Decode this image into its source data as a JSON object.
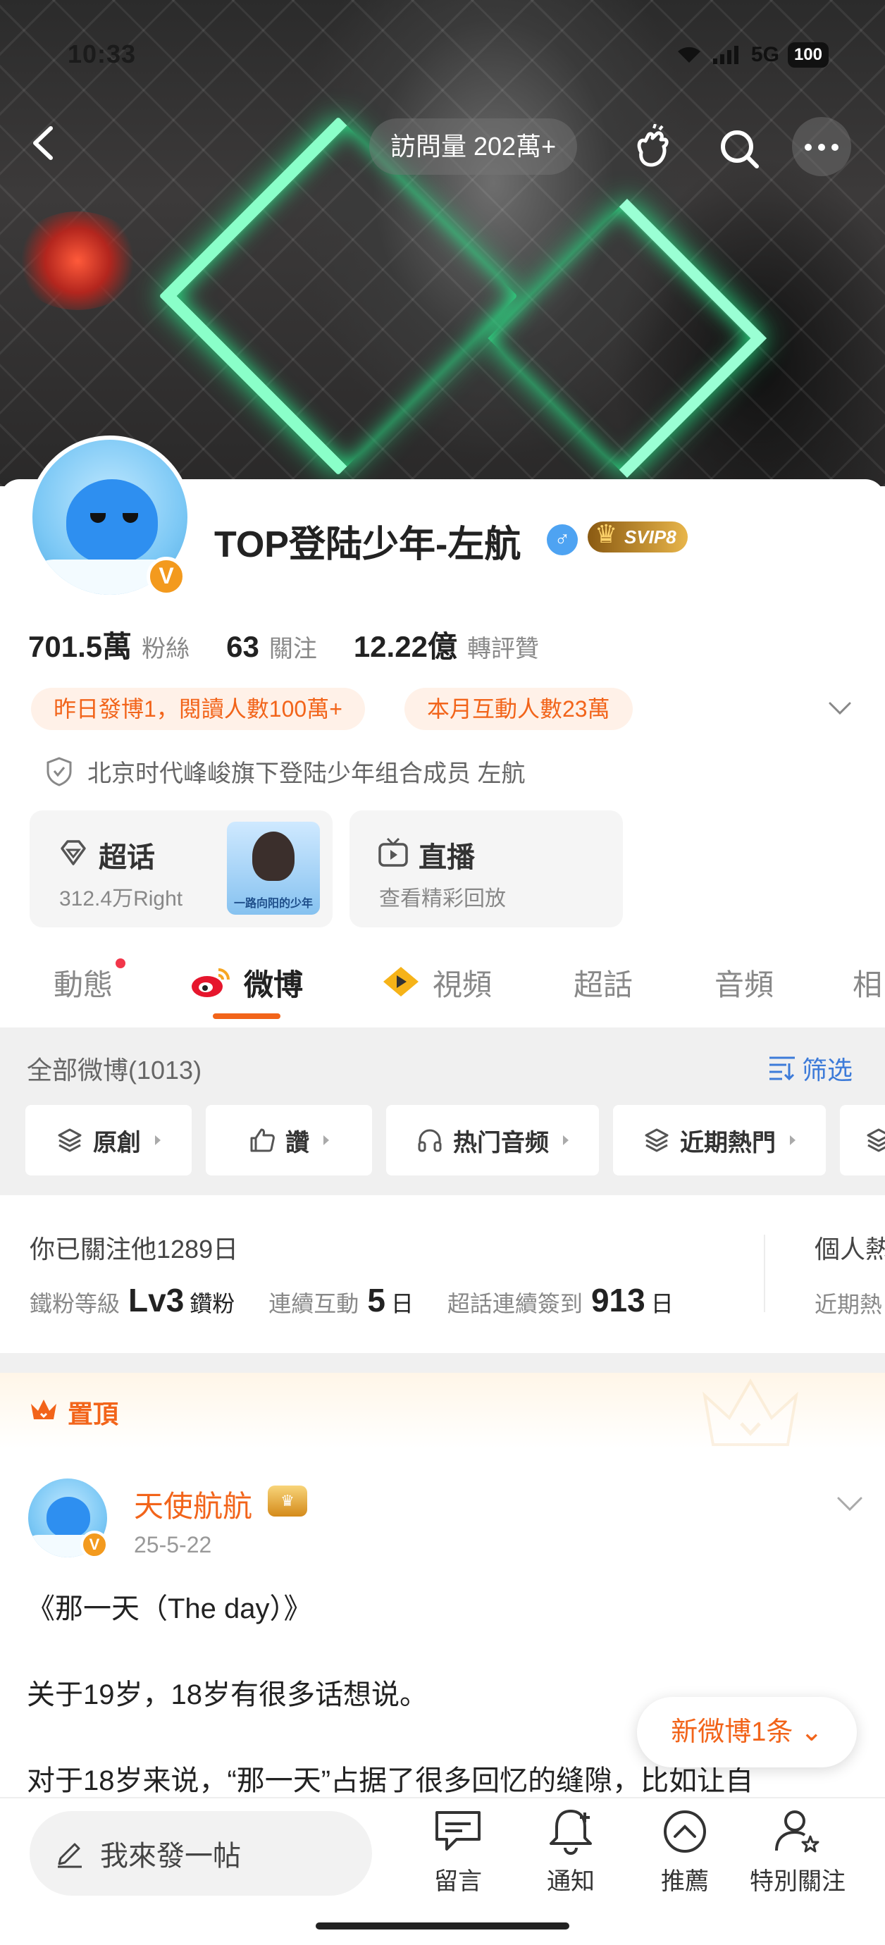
{
  "status": {
    "time": "10:33",
    "network": "5G",
    "battery": "100"
  },
  "topbar": {
    "visits": "訪問量 202萬+"
  },
  "profile": {
    "name": "TOP登陆少年-左航",
    "gender": "♂",
    "svip": "SVIP8",
    "verified_badge": "V",
    "stats": [
      {
        "num": "701.5萬",
        "label": "粉絲"
      },
      {
        "num": "63",
        "label": "關注"
      },
      {
        "num": "12.22億",
        "label": "轉評贊"
      }
    ],
    "pills": [
      "昨日發博1，閱讀人數100萬+",
      "本月互動人數23萬"
    ],
    "cert": "北京时代峰峻旗下登陆少年组合成员 左航",
    "tiles": [
      {
        "title": "超话",
        "sub": "312.4万Right",
        "thumb_label": "一路向阳的少年"
      },
      {
        "title": "直播",
        "sub": "查看精彩回放"
      }
    ]
  },
  "tabs": [
    "動態",
    "微博",
    "視頻",
    "超話",
    "音頻",
    "相"
  ],
  "filter": {
    "all": "全部微博(1013)",
    "filter_label": "筛选",
    "chips": [
      "原創",
      "讚",
      "热门音频",
      "近期熱門",
      ""
    ]
  },
  "fan": {
    "follow_days": "你已關注他1289日",
    "level_label": "鐵粉等級",
    "level": "Lv3",
    "level_unit": "鑽粉",
    "interact_label": "連續互動",
    "interact": "5",
    "interact_unit": "日",
    "checkin_label": "超話連續簽到",
    "checkin": "913",
    "checkin_unit": "日",
    "side1": "個人熱",
    "side2": "近期熱"
  },
  "pinned": {
    "label": "置頂"
  },
  "post": {
    "author": "天使航航",
    "badge": "♛",
    "date": "25-5-22",
    "lines": [
      "《那一天（The day）》",
      "关于19岁，18岁有很多话想说。",
      "对于18岁来说，“那一天”占据了很多回忆的缝隙，比如让自"
    ]
  },
  "new_post": "新微博1条",
  "bottom": {
    "compose": "我來發一帖",
    "items": [
      "留言",
      "通知",
      "推薦",
      "特別關注"
    ]
  }
}
